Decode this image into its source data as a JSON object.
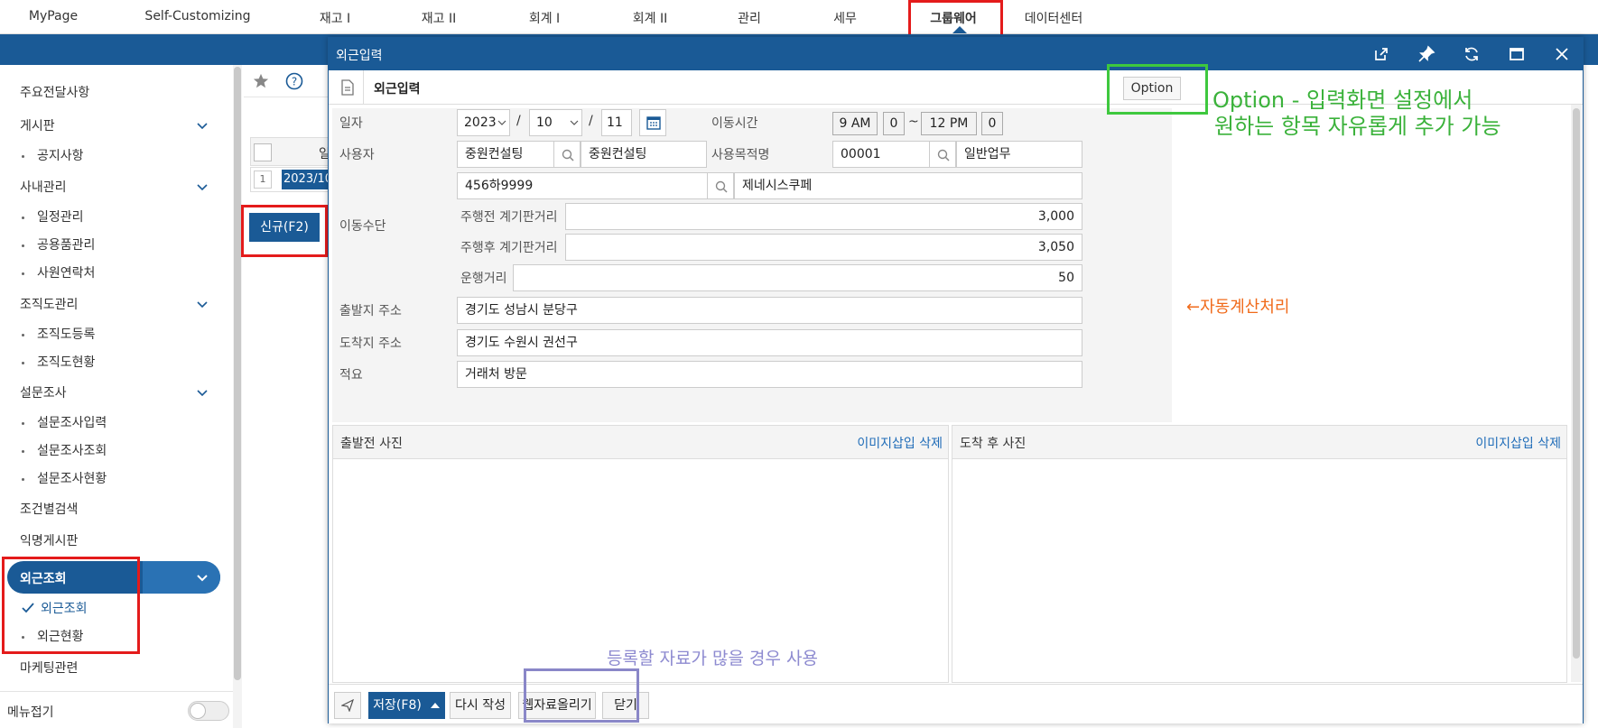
{
  "topnav": {
    "tabs": [
      {
        "label": "MyPage"
      },
      {
        "label": "Self-Customizing"
      },
      {
        "label": "재고 I"
      },
      {
        "label": "재고 II"
      },
      {
        "label": "회계 I"
      },
      {
        "label": "회계 II"
      },
      {
        "label": "관리"
      },
      {
        "label": "세무"
      },
      {
        "label": "그룹웨어"
      },
      {
        "label": "데이터센터"
      }
    ],
    "active_index": 8
  },
  "sidebar": {
    "items": [
      {
        "label": "주요전달사항"
      },
      {
        "label": "게시판"
      },
      {
        "label": "공지사항"
      },
      {
        "label": "사내관리"
      },
      {
        "label": "일정관리"
      },
      {
        "label": "공용품관리"
      },
      {
        "label": "사원연락처"
      },
      {
        "label": "조직도관리"
      },
      {
        "label": "조직도등록"
      },
      {
        "label": "조직도현황"
      },
      {
        "label": "설문조사"
      },
      {
        "label": "설문조사입력"
      },
      {
        "label": "설문조사조회"
      },
      {
        "label": "설문조사현황"
      },
      {
        "label": "조건별검색"
      },
      {
        "label": "익명게시판"
      },
      {
        "label": "외근조회"
      },
      {
        "label": "외근조회"
      },
      {
        "label": "외근현황"
      },
      {
        "label": "마케팅관련"
      }
    ],
    "menu_collapse_label": "메뉴접기"
  },
  "background_page": {
    "grid_header": "일",
    "row_number": "1",
    "row_value": "2023/10",
    "new_button": "신규(F2)"
  },
  "modal": {
    "title": "외근입력",
    "subtitle": "외근입력",
    "option_button": "Option",
    "form": {
      "date_label": "일자",
      "year": "2023",
      "month": "10",
      "day": "11",
      "slash": "/",
      "move_time_label": "이동시간",
      "time_start": "9 AM",
      "time_start_min": "0",
      "tilde": "~",
      "time_end": "12 PM",
      "time_end_min": "0",
      "user_label": "사용자",
      "user_code": "중원컨설팅",
      "user_name": "중원컨설팅",
      "purpose_label": "사용목적명",
      "purpose_code": "00001",
      "purpose_name": "일반업무",
      "vehicle_label": "이동수단",
      "vehicle_code": "456하9999",
      "vehicle_name": "제네시스쿠페",
      "odometer_before_label": "주행전 계기판거리",
      "odometer_before": "3,000",
      "odometer_after_label": "주행후 계기판거리",
      "odometer_after": "3,050",
      "distance_label": "운행거리",
      "distance": "50",
      "departure_label": "출발지 주소",
      "departure": "경기도 성남시 분당구",
      "arrival_label": "도착지 주소",
      "arrival": "경기도 수원시 권선구",
      "memo_label": "적요",
      "memo": "거래처 방문"
    },
    "photo_before": {
      "title": "출발전 사진",
      "links": "이미지삽입 삭제"
    },
    "photo_after": {
      "title": "도착 후 사진",
      "links": "이미지삽입 삭제"
    },
    "bottom": {
      "save": "저장(F8)",
      "rewrite": "다시 작성",
      "web_upload": "웹자료올리기",
      "close": "닫기"
    }
  },
  "annotations": {
    "option_line1": "Option - 입력화면 설정에서",
    "option_line2": "원하는 항목 자유롭게 추가 가능",
    "auto_calc": "←자동계산처리",
    "bulk_upload": "등록할 자료가 많을 경우 사용"
  },
  "colors": {
    "primary": "#1a5a96",
    "highlight_red": "#e41b1b",
    "highlight_green": "#3ec83e",
    "highlight_purple": "#8a87c8",
    "link_blue": "#1f6cb8"
  }
}
